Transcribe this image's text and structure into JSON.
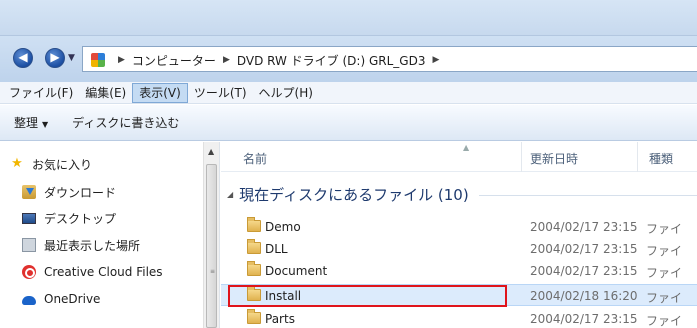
{
  "address": {
    "crumbs": [
      "コンピューター",
      "DVD RW ドライブ (D:) GRL_GD3"
    ]
  },
  "menu": {
    "items": [
      "ファイル(F)",
      "編集(E)",
      "表示(V)",
      "ツール(T)",
      "ヘルプ(H)"
    ],
    "active_index": 2
  },
  "toolbar": {
    "organize_label": "整理",
    "burn_label": "ディスクに書き込む"
  },
  "navpane": {
    "items": [
      {
        "label": "お気に入り",
        "icon": "star-icon"
      },
      {
        "label": "ダウンロード",
        "icon": "download-folder-icon"
      },
      {
        "label": "デスクトップ",
        "icon": "desktop-icon"
      },
      {
        "label": "最近表示した場所",
        "icon": "recent-places-icon"
      },
      {
        "label": "Creative Cloud Files",
        "icon": "creative-cloud-icon"
      },
      {
        "label": "OneDrive",
        "icon": "onedrive-icon"
      }
    ]
  },
  "columns": {
    "name": "名前",
    "modified": "更新日時",
    "type": "種類"
  },
  "group": {
    "label": "現在ディスクにあるファイル (10)"
  },
  "files": [
    {
      "name": "Demo",
      "date": "2004/02/17 23:15",
      "type": "ファイ",
      "selected": false
    },
    {
      "name": "DLL",
      "date": "2004/02/17 23:15",
      "type": "ファイ",
      "selected": false
    },
    {
      "name": "Document",
      "date": "2004/02/17 23:15",
      "type": "ファイ",
      "selected": false
    },
    {
      "name": "Install",
      "date": "2004/02/18 16:20",
      "type": "ファイ",
      "selected": true
    },
    {
      "name": "Parts",
      "date": "2004/02/17 23:15",
      "type": "ファイ",
      "selected": false
    }
  ],
  "colors": {
    "selection": "#dcebfc",
    "annotation_box": "#e0141b",
    "menu_active": "#c4dbf3"
  }
}
